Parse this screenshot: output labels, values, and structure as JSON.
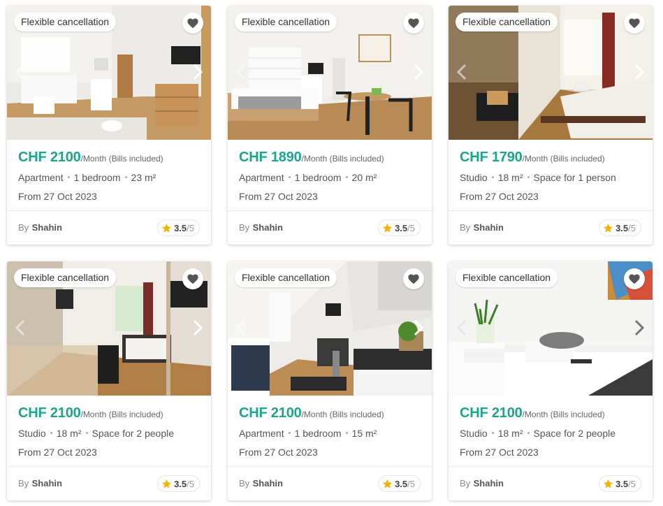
{
  "listings": [
    {
      "badge": "Flexible cancellation",
      "price": "CHF 2100",
      "per": "/Month (Bills included)",
      "meta": [
        "Apartment",
        "1 bedroom",
        "23 m²"
      ],
      "date": "From 27 Oct 2023",
      "by": "By",
      "host": "Shahin",
      "rating": "3.5",
      "rating_max": "/5"
    },
    {
      "badge": "Flexible cancellation",
      "price": "CHF 1890",
      "per": "/Month (Bills included)",
      "meta": [
        "Apartment",
        "1 bedroom",
        "20 m²"
      ],
      "date": "From 27 Oct 2023",
      "by": "By",
      "host": "Shahin",
      "rating": "3.5",
      "rating_max": "/5"
    },
    {
      "badge": "Flexible cancellation",
      "price": "CHF 1790",
      "per": "/Month (Bills included)",
      "meta": [
        "Studio",
        "18 m²",
        "Space for 1 person"
      ],
      "date": "From 27 Oct 2023",
      "by": "By",
      "host": "Shahin",
      "rating": "3.5",
      "rating_max": "/5"
    },
    {
      "badge": "Flexible cancellation",
      "price": "CHF 2100",
      "per": "/Month (Bills included)",
      "meta": [
        "Studio",
        "18 m²",
        "Space for 2 people"
      ],
      "date": "From 27 Oct 2023",
      "by": "By",
      "host": "Shahin",
      "rating": "3.5",
      "rating_max": "/5"
    },
    {
      "badge": "Flexible cancellation",
      "price": "CHF 2100",
      "per": "/Month (Bills included)",
      "meta": [
        "Apartment",
        "1 bedroom",
        "15 m²"
      ],
      "date": "From 27 Oct 2023",
      "by": "By",
      "host": "Shahin",
      "rating": "3.5",
      "rating_max": "/5"
    },
    {
      "badge": "Flexible cancellation",
      "price": "CHF 2100",
      "per": "/Month (Bills included)",
      "meta": [
        "Studio",
        "18 m²",
        "Space for 2 people"
      ],
      "date": "From 27 Oct 2023",
      "by": "By",
      "host": "Shahin",
      "rating": "3.5",
      "rating_max": "/5"
    }
  ],
  "icons": {
    "favorite": "heart-icon",
    "prev": "chevron-left-icon",
    "next": "chevron-right-icon",
    "rating": "star-icon"
  },
  "colors": {
    "price": "#1aa58f",
    "star": "#f5b301",
    "heart": "#555555"
  }
}
